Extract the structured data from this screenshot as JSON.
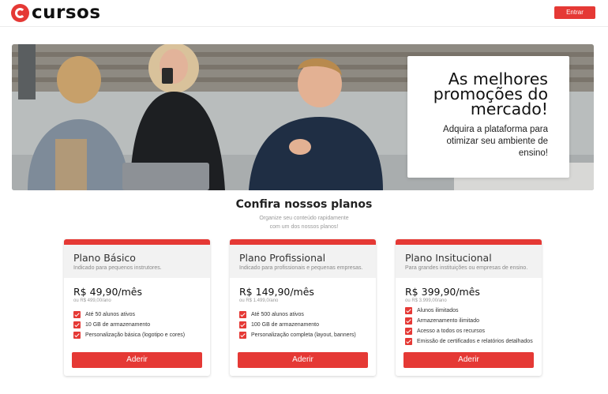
{
  "header": {
    "logo_text": "cursos",
    "login_label": "Entrar"
  },
  "hero": {
    "title": "As melhores promoções do mercado!",
    "subtitle": "Adquira a plataforma para otimizar seu ambiente de ensino!"
  },
  "plans_section": {
    "title": "Confira nossos planos",
    "subtitle_line1": "Organize seu conteúdo rapidamente",
    "subtitle_line2": "com um dos nossos planos!"
  },
  "plans": [
    {
      "name": "Plano Básico",
      "description": "Indicado para pequenos instrutores.",
      "price": "R$ 49,90/mês",
      "annual": "ou R$ 499,00/ano",
      "features": [
        "Até 50 alunos ativos",
        "10 GB de armazenamento",
        "Personalização básica (logotipo e cores)"
      ],
      "button_label": "Aderir"
    },
    {
      "name": "Plano Profissional",
      "description": "Indicado para profissionais e pequenas empresas.",
      "price": "R$ 149,90/mês",
      "annual": "ou R$ 1.499,0/ano",
      "features": [
        "Até 500 alunos ativos",
        "100 GB de armazenamento",
        "Personalização completa (layout, banners)"
      ],
      "button_label": "Aderir"
    },
    {
      "name": "Plano Insitucional",
      "description": "Para grandes instituições ou empresas de ensino.",
      "price": "R$ 399,90/mês",
      "annual": "ou R$ 3.999,00/ano",
      "features": [
        "Alunos ilimitados",
        "Armazenamento ilimitado",
        "Acesso a todos os recursos",
        "Emissão de certificados e relatórios detalhados"
      ],
      "button_label": "Aderir"
    }
  ],
  "colors": {
    "accent": "#e53935"
  }
}
